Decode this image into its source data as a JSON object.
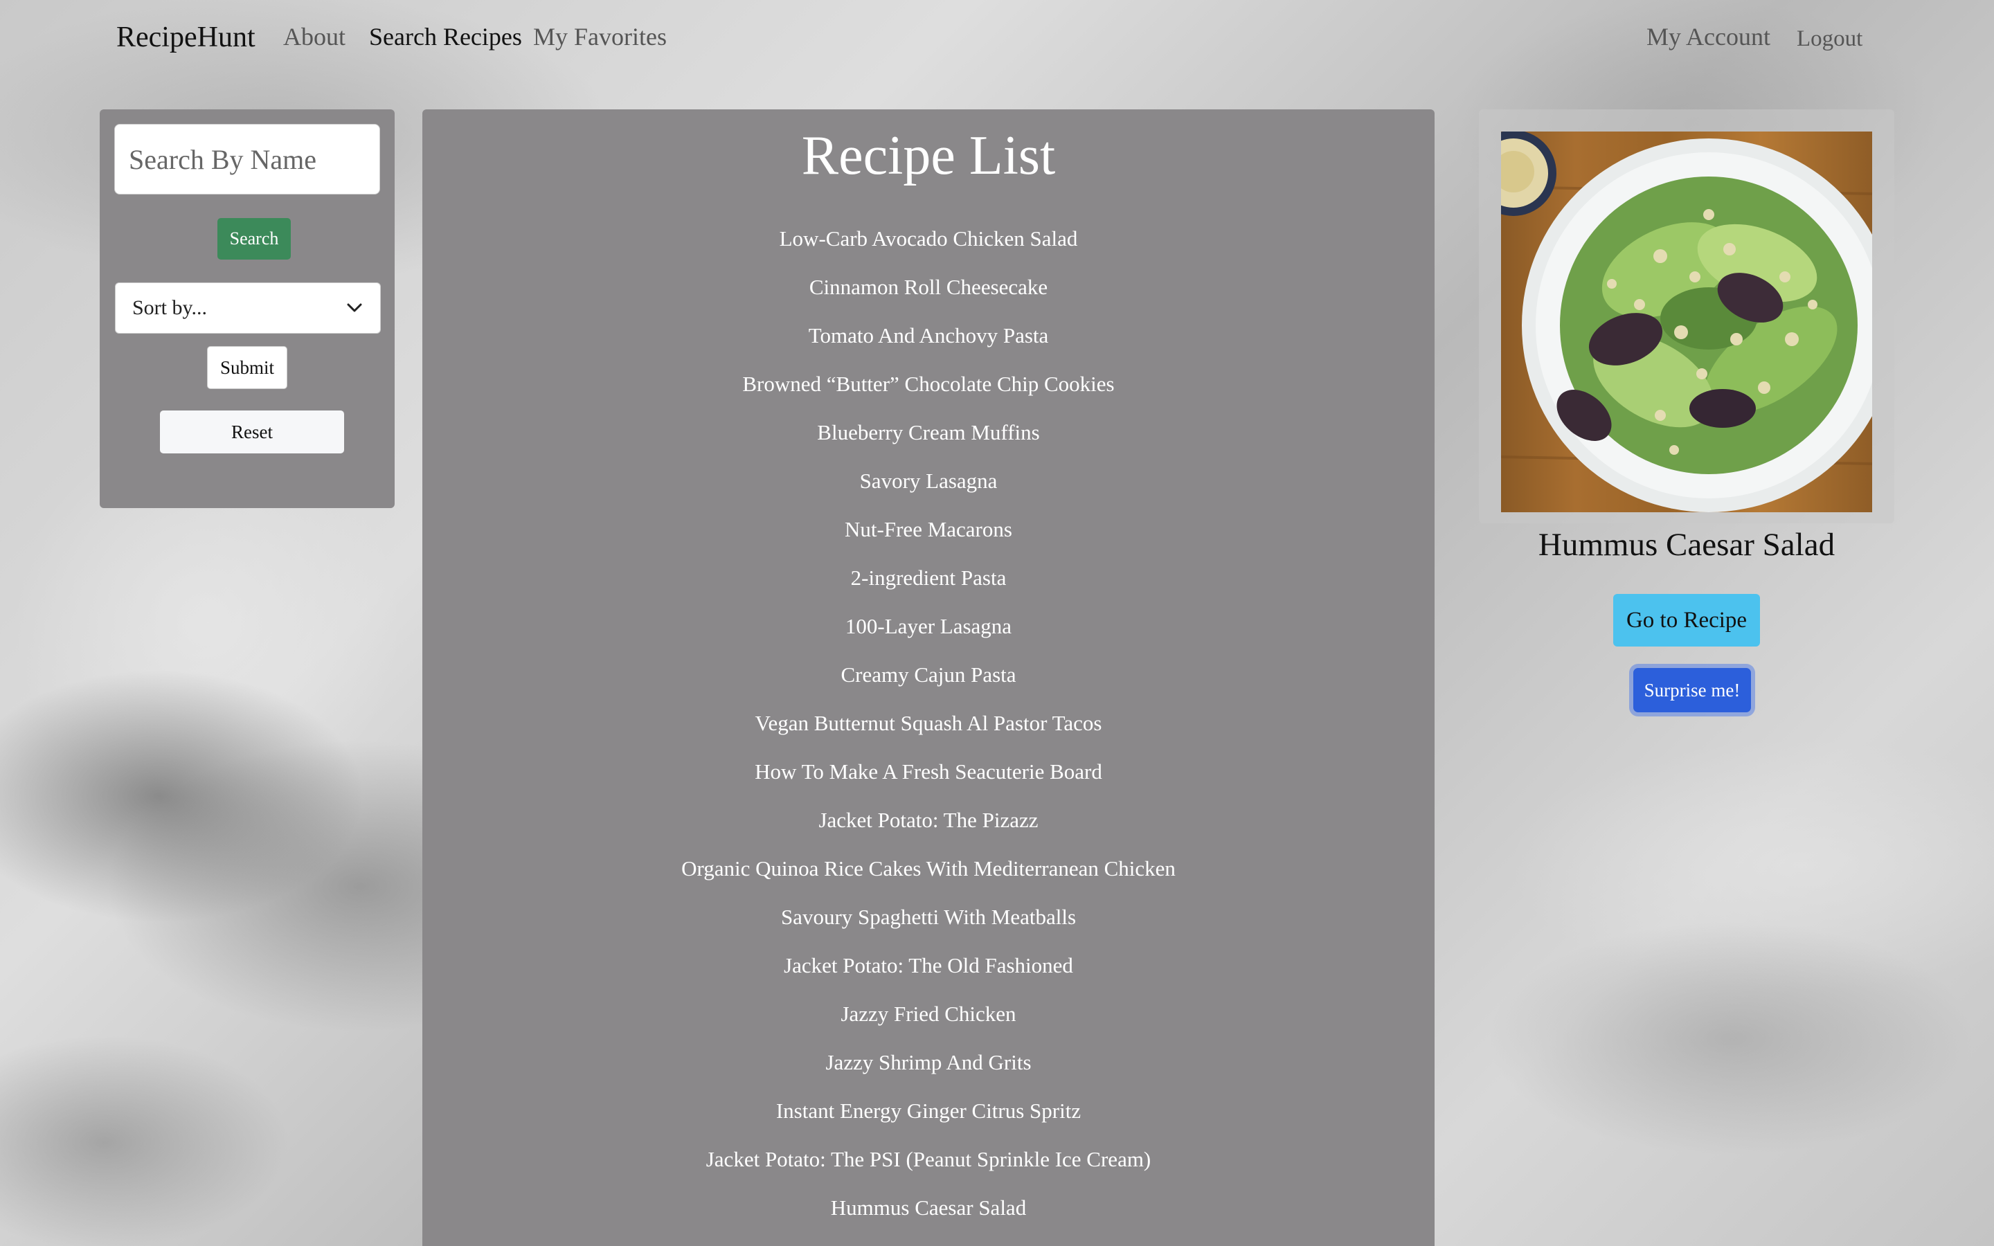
{
  "nav": {
    "brand": "RecipeHunt",
    "about": "About",
    "search_recipes": "Search Recipes",
    "my_favorites": "My Favorites",
    "my_account": "My Account",
    "logout": "Logout"
  },
  "sidebar": {
    "search_placeholder": "Search By Name",
    "search_button": "Search",
    "sort_selected": "Sort by...",
    "submit_button": "Submit",
    "reset_button": "Reset"
  },
  "recipes": {
    "title": "Recipe List",
    "items": [
      "Low-Carb Avocado Chicken Salad",
      "Cinnamon Roll Cheesecake",
      "Tomato And Anchovy Pasta",
      "Browned “Butter” Chocolate Chip Cookies",
      "Blueberry Cream Muffins",
      "Savory Lasagna",
      "Nut-Free Macarons",
      "2-ingredient Pasta",
      "100-Layer Lasagna",
      "Creamy Cajun Pasta",
      "Vegan Butternut Squash Al Pastor Tacos",
      "How To Make A Fresh Seacuterie Board",
      "Jacket Potato: The Pizazz",
      "Organic Quinoa Rice Cakes With Mediterranean Chicken",
      "Savoury Spaghetti With Meatballs",
      "Jacket Potato: The Old Fashioned",
      "Jazzy Fried Chicken",
      "Jazzy Shrimp And Grits",
      "Instant Energy Ginger Citrus Spritz",
      "Jacket Potato: The PSI (Peanut Sprinkle Ice Cream)",
      "Hummus Caesar Salad"
    ]
  },
  "featured": {
    "title": "Hummus Caesar Salad",
    "go_button": "Go to Recipe",
    "surprise_button": "Surprise me!"
  },
  "colors": {
    "panel": "#8a888a",
    "search_button": "#3c8a5a",
    "go_button": "#4cc2ee",
    "surprise_button": "#2c5fdb"
  }
}
